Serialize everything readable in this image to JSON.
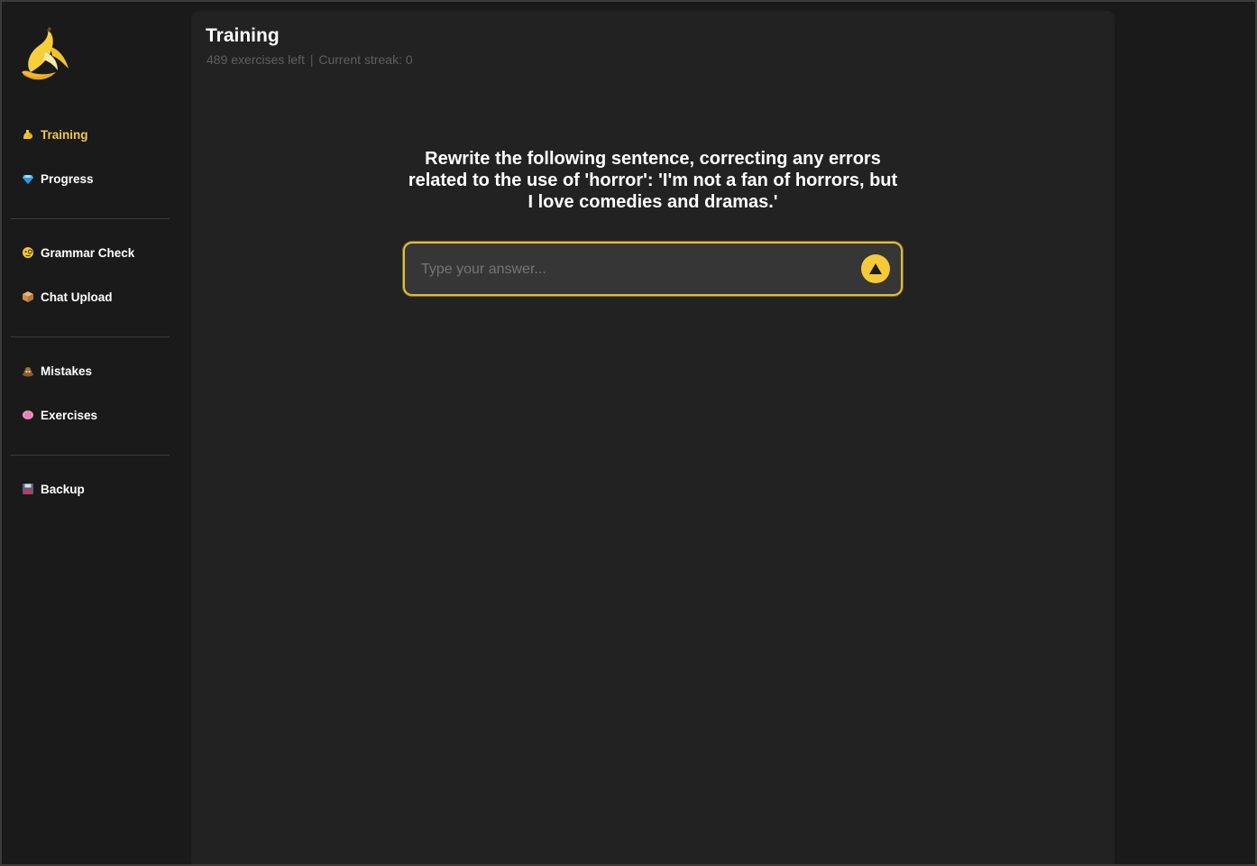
{
  "app": {
    "logo_icon": "banana-icon",
    "accent_color": "#f5c842"
  },
  "sidebar": {
    "groups": [
      [
        {
          "label": "Training",
          "icon": "flexed-biceps-icon",
          "active": true
        },
        {
          "label": "Progress",
          "icon": "gem-icon",
          "active": false
        }
      ],
      [
        {
          "label": "Grammar Check",
          "icon": "monocle-face-icon",
          "active": false
        },
        {
          "label": "Chat Upload",
          "icon": "package-icon",
          "active": false
        }
      ],
      [
        {
          "label": "Mistakes",
          "icon": "pile-of-poo-icon",
          "active": false
        },
        {
          "label": "Exercises",
          "icon": "brain-icon",
          "active": false
        }
      ],
      [
        {
          "label": "Backup",
          "icon": "floppy-disk-icon",
          "active": false
        }
      ]
    ]
  },
  "main": {
    "title": "Training",
    "exercises_left": "489 exercises left",
    "streak": "Current streak: 0",
    "question": "Rewrite the following sentence, correcting any errors related to the use of 'horror': 'I'm not a fan of horrors, but I love comedies and dramas.'",
    "answer": {
      "value": "",
      "placeholder": "Type your answer..."
    },
    "submit_icon": "triangle-up-icon"
  }
}
